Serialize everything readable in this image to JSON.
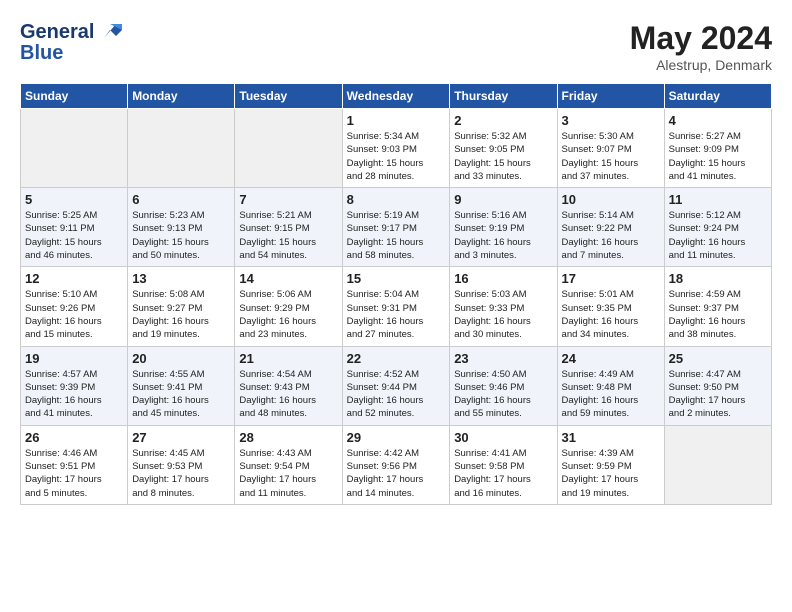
{
  "header": {
    "logo_general": "General",
    "logo_blue": "Blue",
    "month_year": "May 2024",
    "location": "Alestrup, Denmark"
  },
  "weekdays": [
    "Sunday",
    "Monday",
    "Tuesday",
    "Wednesday",
    "Thursday",
    "Friday",
    "Saturday"
  ],
  "weeks": [
    [
      {
        "day": "",
        "info": ""
      },
      {
        "day": "",
        "info": ""
      },
      {
        "day": "",
        "info": ""
      },
      {
        "day": "1",
        "info": "Sunrise: 5:34 AM\nSunset: 9:03 PM\nDaylight: 15 hours\nand 28 minutes."
      },
      {
        "day": "2",
        "info": "Sunrise: 5:32 AM\nSunset: 9:05 PM\nDaylight: 15 hours\nand 33 minutes."
      },
      {
        "day": "3",
        "info": "Sunrise: 5:30 AM\nSunset: 9:07 PM\nDaylight: 15 hours\nand 37 minutes."
      },
      {
        "day": "4",
        "info": "Sunrise: 5:27 AM\nSunset: 9:09 PM\nDaylight: 15 hours\nand 41 minutes."
      }
    ],
    [
      {
        "day": "5",
        "info": "Sunrise: 5:25 AM\nSunset: 9:11 PM\nDaylight: 15 hours\nand 46 minutes."
      },
      {
        "day": "6",
        "info": "Sunrise: 5:23 AM\nSunset: 9:13 PM\nDaylight: 15 hours\nand 50 minutes."
      },
      {
        "day": "7",
        "info": "Sunrise: 5:21 AM\nSunset: 9:15 PM\nDaylight: 15 hours\nand 54 minutes."
      },
      {
        "day": "8",
        "info": "Sunrise: 5:19 AM\nSunset: 9:17 PM\nDaylight: 15 hours\nand 58 minutes."
      },
      {
        "day": "9",
        "info": "Sunrise: 5:16 AM\nSunset: 9:19 PM\nDaylight: 16 hours\nand 3 minutes."
      },
      {
        "day": "10",
        "info": "Sunrise: 5:14 AM\nSunset: 9:22 PM\nDaylight: 16 hours\nand 7 minutes."
      },
      {
        "day": "11",
        "info": "Sunrise: 5:12 AM\nSunset: 9:24 PM\nDaylight: 16 hours\nand 11 minutes."
      }
    ],
    [
      {
        "day": "12",
        "info": "Sunrise: 5:10 AM\nSunset: 9:26 PM\nDaylight: 16 hours\nand 15 minutes."
      },
      {
        "day": "13",
        "info": "Sunrise: 5:08 AM\nSunset: 9:27 PM\nDaylight: 16 hours\nand 19 minutes."
      },
      {
        "day": "14",
        "info": "Sunrise: 5:06 AM\nSunset: 9:29 PM\nDaylight: 16 hours\nand 23 minutes."
      },
      {
        "day": "15",
        "info": "Sunrise: 5:04 AM\nSunset: 9:31 PM\nDaylight: 16 hours\nand 27 minutes."
      },
      {
        "day": "16",
        "info": "Sunrise: 5:03 AM\nSunset: 9:33 PM\nDaylight: 16 hours\nand 30 minutes."
      },
      {
        "day": "17",
        "info": "Sunrise: 5:01 AM\nSunset: 9:35 PM\nDaylight: 16 hours\nand 34 minutes."
      },
      {
        "day": "18",
        "info": "Sunrise: 4:59 AM\nSunset: 9:37 PM\nDaylight: 16 hours\nand 38 minutes."
      }
    ],
    [
      {
        "day": "19",
        "info": "Sunrise: 4:57 AM\nSunset: 9:39 PM\nDaylight: 16 hours\nand 41 minutes."
      },
      {
        "day": "20",
        "info": "Sunrise: 4:55 AM\nSunset: 9:41 PM\nDaylight: 16 hours\nand 45 minutes."
      },
      {
        "day": "21",
        "info": "Sunrise: 4:54 AM\nSunset: 9:43 PM\nDaylight: 16 hours\nand 48 minutes."
      },
      {
        "day": "22",
        "info": "Sunrise: 4:52 AM\nSunset: 9:44 PM\nDaylight: 16 hours\nand 52 minutes."
      },
      {
        "day": "23",
        "info": "Sunrise: 4:50 AM\nSunset: 9:46 PM\nDaylight: 16 hours\nand 55 minutes."
      },
      {
        "day": "24",
        "info": "Sunrise: 4:49 AM\nSunset: 9:48 PM\nDaylight: 16 hours\nand 59 minutes."
      },
      {
        "day": "25",
        "info": "Sunrise: 4:47 AM\nSunset: 9:50 PM\nDaylight: 17 hours\nand 2 minutes."
      }
    ],
    [
      {
        "day": "26",
        "info": "Sunrise: 4:46 AM\nSunset: 9:51 PM\nDaylight: 17 hours\nand 5 minutes."
      },
      {
        "day": "27",
        "info": "Sunrise: 4:45 AM\nSunset: 9:53 PM\nDaylight: 17 hours\nand 8 minutes."
      },
      {
        "day": "28",
        "info": "Sunrise: 4:43 AM\nSunset: 9:54 PM\nDaylight: 17 hours\nand 11 minutes."
      },
      {
        "day": "29",
        "info": "Sunrise: 4:42 AM\nSunset: 9:56 PM\nDaylight: 17 hours\nand 14 minutes."
      },
      {
        "day": "30",
        "info": "Sunrise: 4:41 AM\nSunset: 9:58 PM\nDaylight: 17 hours\nand 16 minutes."
      },
      {
        "day": "31",
        "info": "Sunrise: 4:39 AM\nSunset: 9:59 PM\nDaylight: 17 hours\nand 19 minutes."
      },
      {
        "day": "",
        "info": ""
      }
    ]
  ]
}
